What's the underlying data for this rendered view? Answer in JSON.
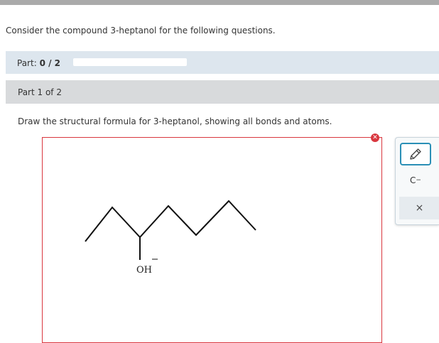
{
  "intro_text": "Consider the compound 3-heptanol for the following questions.",
  "part_progress": {
    "label": "Part:",
    "value": "0 / 2",
    "fraction": 0
  },
  "part_header": "Part 1 of 2",
  "question": "Draw the structural formula for 3-heptanol, showing all bonds and atoms.",
  "canvas": {
    "atom_label": "OH",
    "error_icon": "x-circle-icon"
  },
  "toolbar": {
    "pencil_icon": "pencil-icon",
    "charge_label": "C",
    "charge_sup": "−",
    "clear_label": "×"
  },
  "colors": {
    "accent": "#2a8fb6",
    "error": "#d9363e",
    "part_bar": "#dde6ee",
    "part_header": "#d8dadc"
  }
}
